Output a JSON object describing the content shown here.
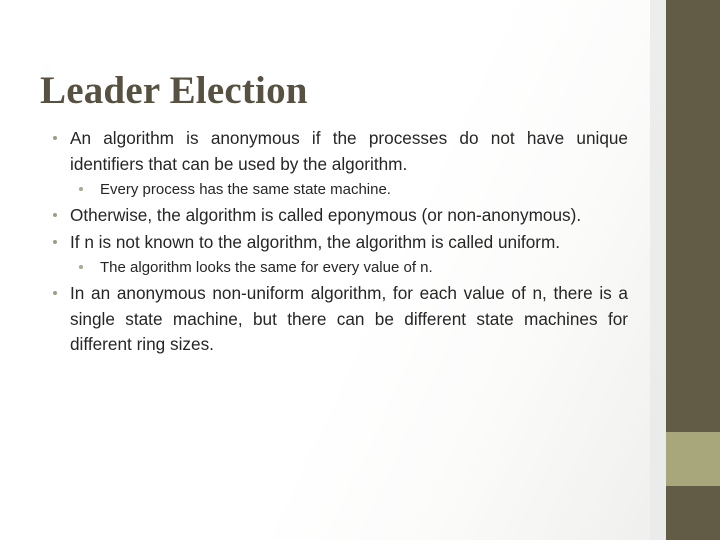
{
  "slide": {
    "title": "Leader Election",
    "title_color": "#575142",
    "background_color": "#ffffff",
    "accent_dark": "#625c46",
    "accent_light": "#a8a77c",
    "bullet_color_level1": "#9aa086",
    "bullet_color_level2": "#a6ab95",
    "body_text_color": "#262626"
  },
  "content": {
    "bullets": [
      {
        "level": 1,
        "text": "An algorithm is anonymous if the processes do not have unique identifiers that can be used by the algorithm."
      },
      {
        "level": 2,
        "text": "Every process has the same state machine."
      },
      {
        "level": 1,
        "text": " Otherwise, the algorithm is called eponymous (or non-anonymous)."
      },
      {
        "level": 1,
        "text": " If n is not known to the algorithm, the algorithm is called uniform."
      },
      {
        "level": 2,
        "text": "The algorithm looks the same for every value of n."
      },
      {
        "level": 1,
        "text": " In an anonymous non-uniform algorithm, for each value of n, there is a single state machine, but there can be different state machines for different ring sizes."
      }
    ]
  }
}
